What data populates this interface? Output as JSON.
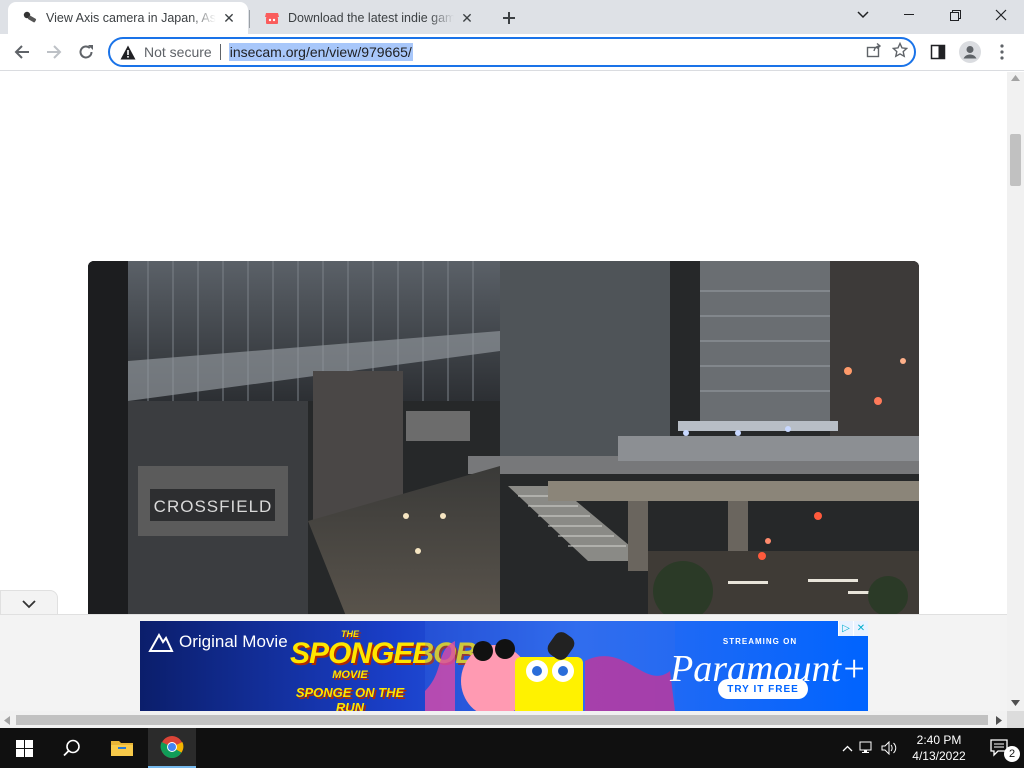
{
  "browser": {
    "tabs": [
      {
        "title": "View Axis camera in Japan, Asahi",
        "favicon": "camera-favicon-icon",
        "active": true
      },
      {
        "title": "Download the latest indie games",
        "favicon": "itch-favicon-icon",
        "active": false
      }
    ],
    "new_tab_icon": "plus-icon",
    "window_controls": [
      "chevron-down-icon",
      "minimize-icon",
      "restore-icon",
      "close-icon"
    ],
    "toolbar": {
      "security_label": "Not secure",
      "url": "insecam.org/en/view/979665/"
    }
  },
  "ad": {
    "original_movie": "Original Movie",
    "title_top": "THE",
    "title_main": "SPONGEBOB",
    "title_sub": "MOVIE",
    "tagline": "SPONGE ON THE RUN",
    "streaming": "STREAMING ON",
    "brand": "Paramount+",
    "cta": "TRY IT FREE",
    "info_glyph": "▷",
    "close_glyph": "✕",
    "colors": {
      "brand_blue": "#0064ff",
      "spongebob_yellow": "#ffe600"
    }
  },
  "taskbar": {
    "apps": [
      "windows-start-icon",
      "search-icon",
      "file-explorer-icon",
      "chrome-icon"
    ],
    "time": "2:40 PM",
    "date": "4/13/2022",
    "notification_count": "2"
  }
}
